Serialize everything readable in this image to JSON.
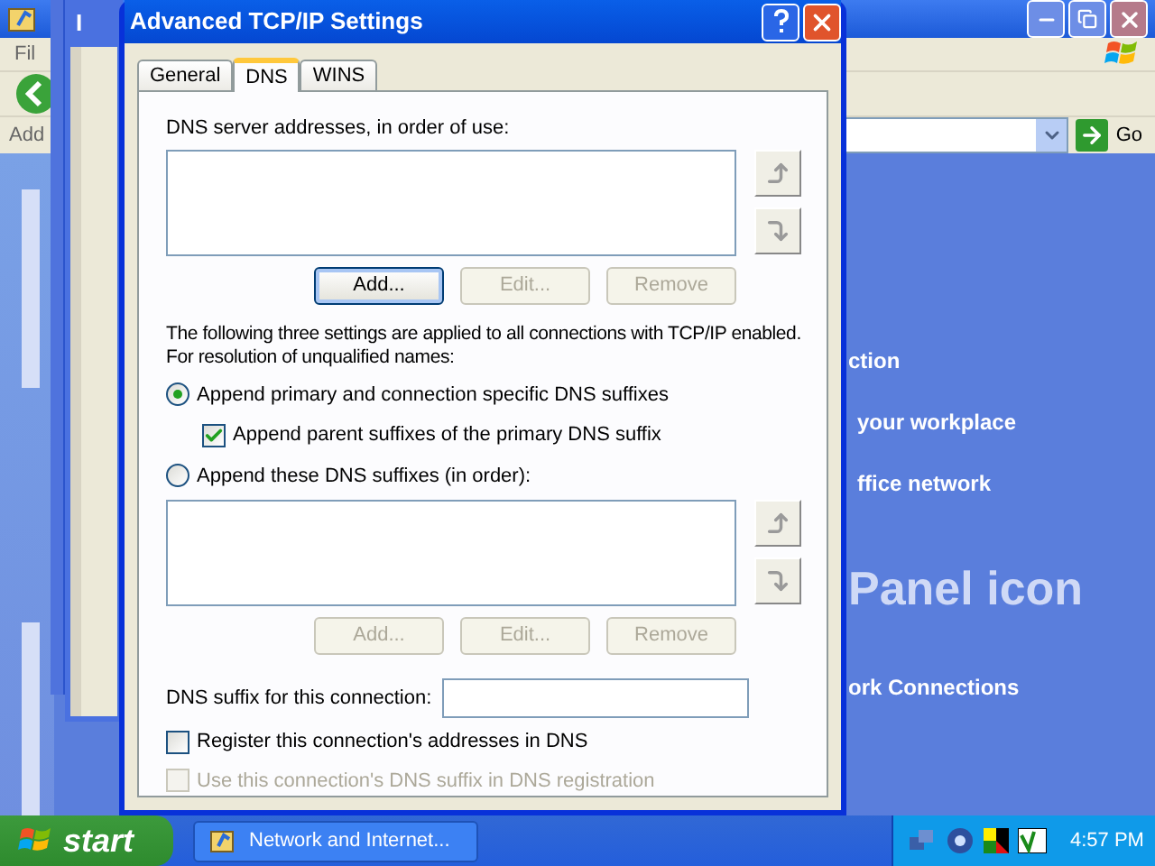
{
  "background_window": {
    "menu_text": "Fil",
    "address_label": "Add",
    "go_button": "Go",
    "links": [
      "ction",
      "your workplace",
      "ffice network"
    ],
    "heading": "Panel icon",
    "bottom_link": "ork Connections"
  },
  "stacked_window": {
    "title": "I"
  },
  "dialog": {
    "title": "Advanced TCP/IP Settings",
    "tabs": [
      {
        "label": "General",
        "selected": false
      },
      {
        "label": "DNS",
        "selected": true
      },
      {
        "label": "WINS",
        "selected": false
      }
    ],
    "server_label": "DNS server addresses, in order of use:",
    "server_buttons": [
      {
        "label": "Add...",
        "disabled": false,
        "default": true
      },
      {
        "label": "Edit...",
        "disabled": true
      },
      {
        "label": "Remove",
        "disabled": true
      }
    ],
    "description": "The following three settings are applied to all connections with TCP/IP enabled. For resolution of unqualified names:",
    "radios": [
      {
        "label": "Append primary and connection specific DNS suffixes",
        "selected": true,
        "children": [
          {
            "label": "Append parent suffixes of the primary DNS suffix",
            "checked": true
          }
        ]
      },
      {
        "label": "Append these DNS suffixes (in order):",
        "selected": false
      }
    ],
    "suffix_buttons": [
      {
        "label": "Add...",
        "disabled": true
      },
      {
        "label": "Edit...",
        "disabled": true
      },
      {
        "label": "Remove",
        "disabled": true
      }
    ],
    "suffix_field_label": "DNS suffix for this connection:",
    "checkboxes": [
      {
        "label": "Register this connection's addresses in DNS",
        "checked": false,
        "disabled": false
      },
      {
        "label": "Use this connection's DNS suffix in DNS registration",
        "checked": false,
        "disabled": true
      }
    ]
  },
  "taskbar": {
    "start": "start",
    "task": "Network and Internet...",
    "clock": "4:57 PM"
  }
}
